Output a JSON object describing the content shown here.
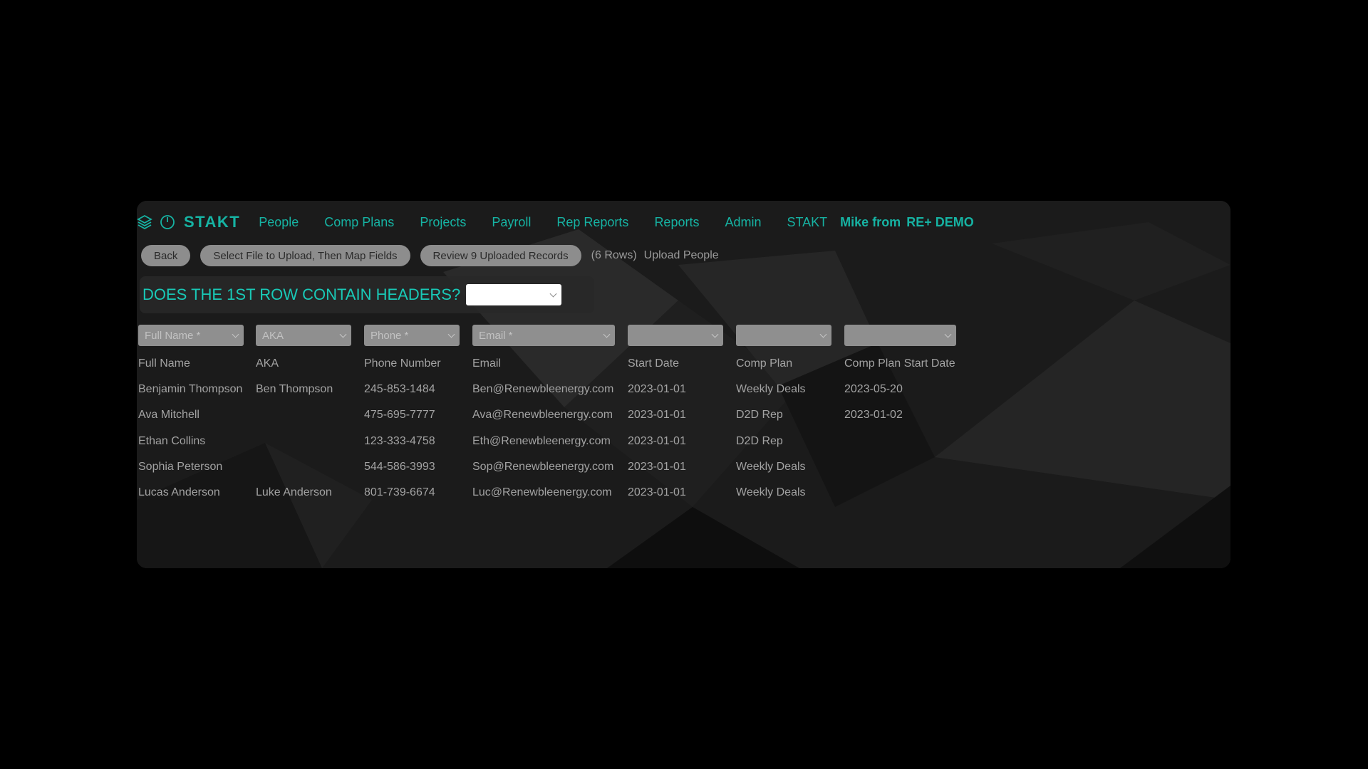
{
  "nav": {
    "brand": "STAKT",
    "items": [
      "People",
      "Comp Plans",
      "Projects",
      "Payroll",
      "Rep Reports",
      "Reports",
      "Admin",
      "STAKT"
    ],
    "user_prefix": "Mike from",
    "user_org": "RE+ DEMO",
    "accent_color": "#16b3a3"
  },
  "toolbar": {
    "back_label": "Back",
    "select_file_label": "Select File to Upload, Then Map Fields",
    "review_label": "Review 9 Uploaded Records",
    "rows_text": "(6 Rows)",
    "upload_label": "Upload People"
  },
  "headers_question": {
    "text": "DOES THE 1ST ROW CONTAIN HEADERS?",
    "selected": ""
  },
  "field_mapping": [
    "Full Name *",
    "AKA",
    "Phone *",
    "Email *",
    "",
    "",
    ""
  ],
  "table": {
    "rows": [
      [
        "Full Name",
        "AKA",
        "Phone Number",
        "Email",
        "Start Date",
        "Comp Plan",
        "Comp Plan Start Date"
      ],
      [
        "Benjamin Thompson",
        "Ben Thompson",
        "245-853-1484",
        "Ben@Renewbleenergy.com",
        "2023-01-01",
        "Weekly Deals",
        "2023-05-20"
      ],
      [
        "Ava Mitchell",
        "",
        "475-695-7777",
        "Ava@Renewbleenergy.com",
        "2023-01-01",
        "D2D Rep",
        "2023-01-02"
      ],
      [
        "Ethan Collins",
        "",
        "123-333-4758",
        "Eth@Renewbleenergy.com",
        "2023-01-01",
        "D2D Rep",
        ""
      ],
      [
        "Sophia Peterson",
        "",
        "544-586-3993",
        "Sop@Renewbleenergy.com",
        "2023-01-01",
        "Weekly Deals",
        ""
      ],
      [
        "Lucas Anderson",
        "Luke Anderson",
        "801-739-6674",
        "Luc@Renewbleenergy.com",
        "2023-01-01",
        "Weekly Deals",
        ""
      ]
    ]
  }
}
